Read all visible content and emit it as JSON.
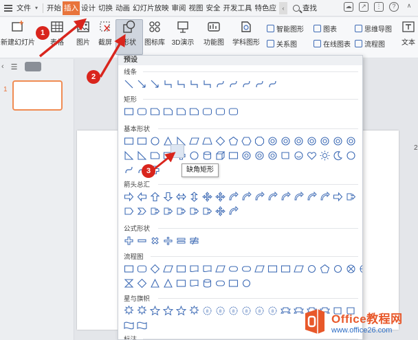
{
  "menu": {
    "file": "文件",
    "tabs": [
      "开始",
      "插入",
      "设计",
      "切换",
      "动画",
      "幻灯片放映",
      "审阅",
      "视图",
      "安全",
      "开发工具",
      "特色应"
    ],
    "active_tab": "插入",
    "search": "查找"
  },
  "ribbon": {
    "new_slide": "新建幻灯片",
    "table": "表格",
    "picture": "图片",
    "screenshot": "截屏",
    "shape": "形状",
    "icon_lib": "图标库",
    "demo3d": "3D演示",
    "func_chart": "功能图",
    "sci_shape": "学科图形",
    "smart_art": "智能图形",
    "chart": "图表",
    "mind_map": "思维导图",
    "relation": "关系图",
    "online_chart": "在线图表",
    "flowchart": "流程图",
    "text": "文本"
  },
  "thumbnails": {
    "slide_number": "1"
  },
  "canvas": {
    "right_marker": "2"
  },
  "dropdown": {
    "header": "预设",
    "categories": [
      "线条",
      "矩形",
      "基本形状",
      "箭头总汇",
      "公式形状",
      "流程图",
      "星与旗帜",
      "标注"
    ],
    "tooltip": "缺角矩形"
  },
  "badges": [
    "1",
    "2",
    "3"
  ],
  "watermark": {
    "main": "Office教程网",
    "sub": "www.office26.com"
  },
  "colors": {
    "accent": "#e8743b",
    "annotation": "#d9251d",
    "shape_stroke": "#3e6bb5"
  }
}
